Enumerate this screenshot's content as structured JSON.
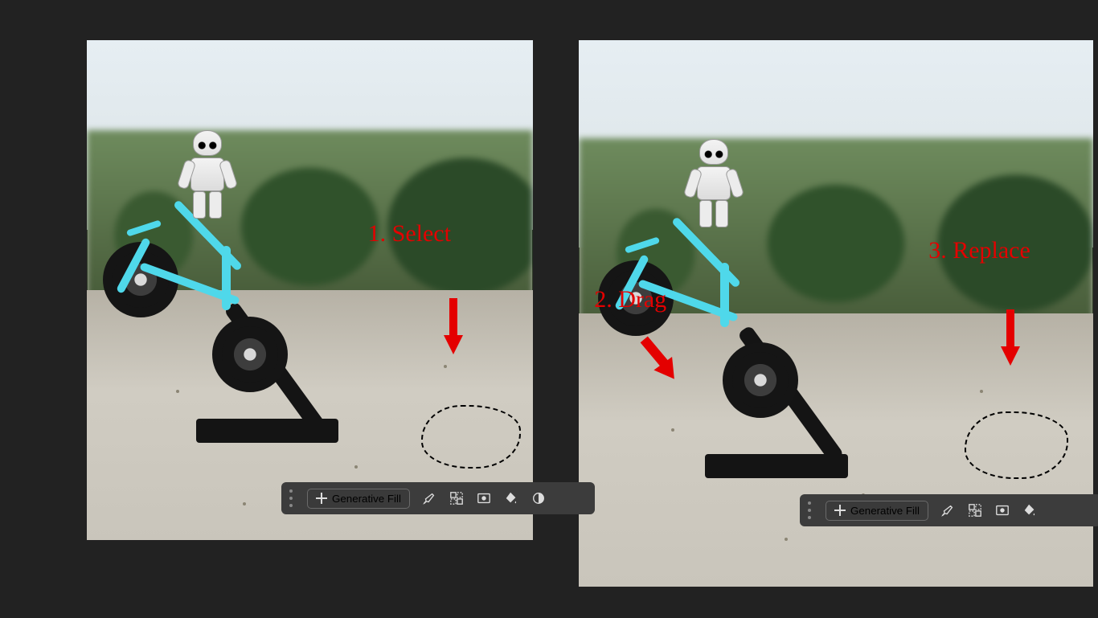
{
  "annotations": {
    "step1": "1. Select",
    "step2": "2. Drag",
    "step3": "3. Replace"
  },
  "taskbar": {
    "generative_fill_label": "Generative Fill",
    "icons": {
      "sparkle": "sparkle-icon",
      "brush": "brush-icon",
      "select_subject": "select-subject-icon",
      "mask": "mask-icon",
      "fill": "fill-bucket-icon",
      "adjust": "adjust-contrast-icon"
    }
  }
}
